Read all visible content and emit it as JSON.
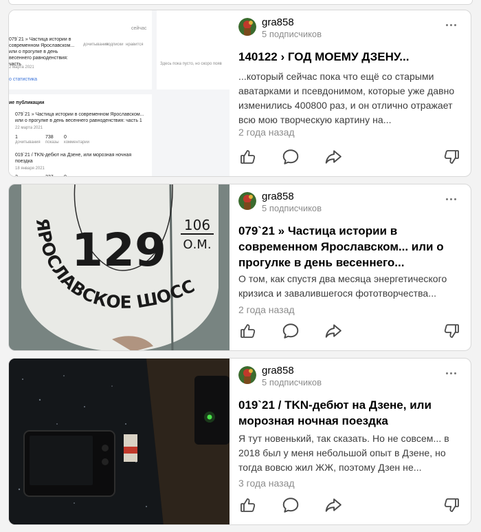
{
  "channel": {
    "name": "gra858",
    "subscribers": "5 подписчиков"
  },
  "cards": [
    {
      "title": "140122 › ГОД МОЕМУ ДЗЕНУ...",
      "snippet": "...который сейчас пока что ещё со старыми аватарками и псевдонимом, которые уже давно изменились 400800 раз, и он отлично отражает всю мою творческую картину на...",
      "date": "2 года назад",
      "thumb_kind": "screenshot"
    },
    {
      "title": "079`21 » Частица истории в современном Ярославском... или о прогулке в день весеннего...",
      "snippet": "О том, как спустя два месяца энергетического кризиса и завалившегося фототворчества...",
      "date": "2 года назад",
      "thumb_kind": "sign"
    },
    {
      "title": "019`21 / TKN-дебют на Дзене, или морозная ночная поездка",
      "snippet": "Я тут новенький, так сказать. Но не совсем... в 2018 был у меня небольшой опыт в Дзене, но тогда вовсю жил ЖЖ, поэтому Дзен не...",
      "date": "3 года назад",
      "thumb_kind": "night"
    }
  ],
  "thumb1": {
    "top_right": "сейчас",
    "post_text": "079`21 » Частица истории в современном Ярославском... или о прогулке в день весеннего равноденствия: часть",
    "stats_labels": [
      "дочитывания",
      "подписки",
      "нравится"
    ],
    "empty_text": "Здесь пока пусто, но скоро появ",
    "date1": "2 марта 2021",
    "stats_link": "о статистика",
    "section": "ие публикации",
    "pub1_title": "079`21 » Частица истории в современном Ярославском... или о прогулке в день весеннего равноденствия: часть 1",
    "pub1_date": "22 марта 2021",
    "pub1_stats": [
      "1",
      "738",
      "0"
    ],
    "pub1_labels": [
      "дочитывания",
      "показы",
      "комментарии"
    ],
    "pub2_title": "019`21 / TKN-дебют на Дзене, или морозная ночная поездка",
    "pub2_date": "18 января 2021",
    "pub2_stats": [
      "2",
      "337",
      "0"
    ]
  },
  "sign": {
    "number": "129",
    "km": "106",
    "om": "О.М.",
    "arc_text": "ЯРОСЛАВСКОЕ ШОССЕ"
  },
  "icons": [
    "like-icon",
    "comment-icon",
    "share-icon",
    "dislike-icon",
    "more-icon"
  ],
  "colors": {
    "title": "#000000",
    "meta": "#8c8c8c",
    "icon": "#4a4a4a"
  }
}
